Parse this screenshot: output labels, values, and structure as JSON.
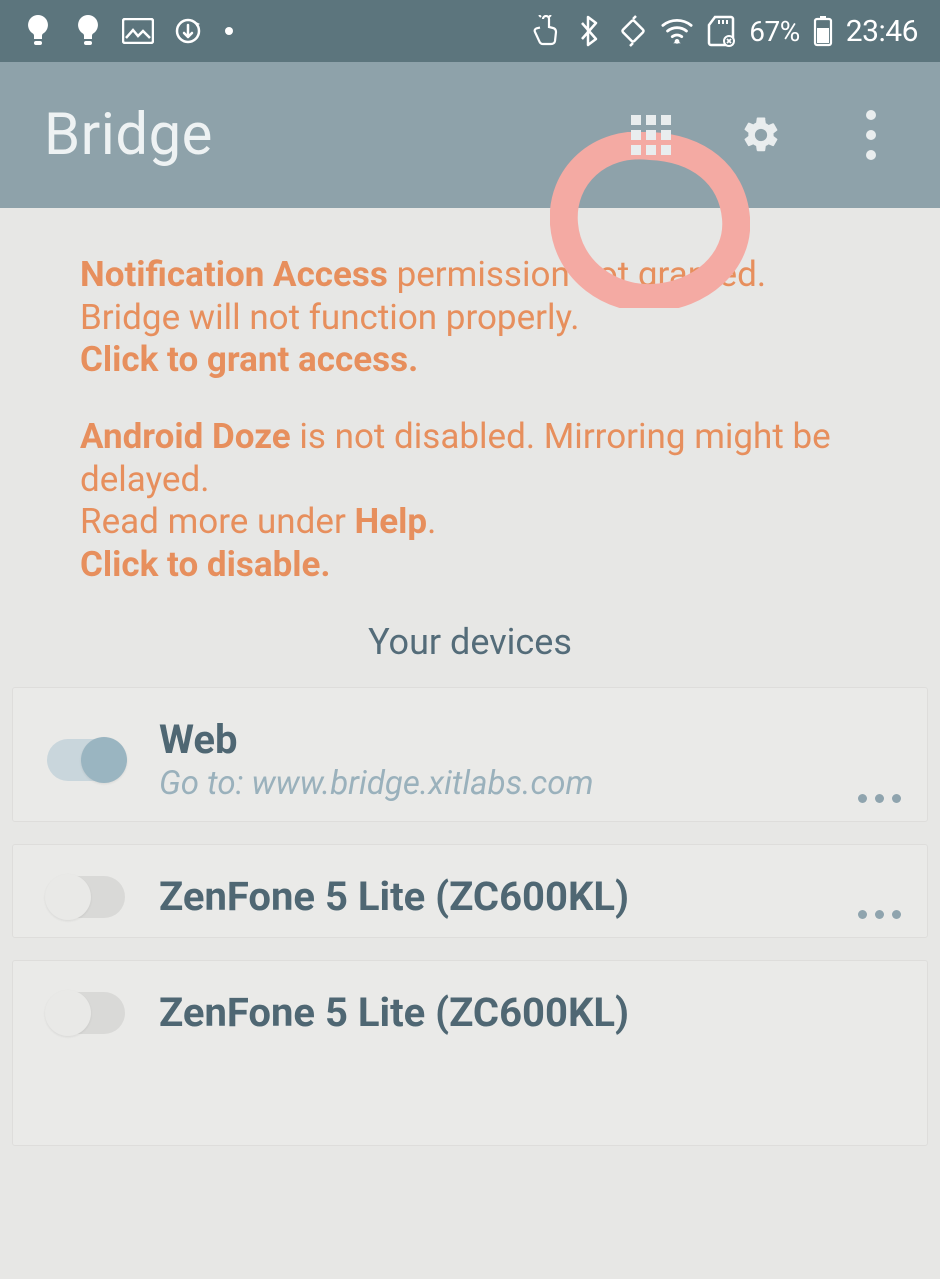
{
  "status": {
    "battery_pct": "67%",
    "time": "23:46"
  },
  "appbar": {
    "title": "Bridge"
  },
  "warnings": {
    "w1_bold": "Notification Access",
    "w1_rest": " permission not granted. Bridge will not function properly.",
    "w1_cta": "Click to grant access.",
    "w2_bold": "Android Doze",
    "w2_rest": " is not disabled. Mirroring might be delayed.",
    "w2_help_pre": "Read more under ",
    "w2_help_bold": "Help",
    "w2_help_post": ".",
    "w2_cta": "Click to disable."
  },
  "section": {
    "devices_header": "Your devices"
  },
  "devices": [
    {
      "name": "Web",
      "sub": "Go to: www.bridge.xitlabs.com",
      "on": true
    },
    {
      "name": "ZenFone 5 Lite (ZC600KL)",
      "sub": "",
      "on": false
    },
    {
      "name": "ZenFone 5 Lite (ZC600KL)",
      "sub": "",
      "on": false
    }
  ]
}
